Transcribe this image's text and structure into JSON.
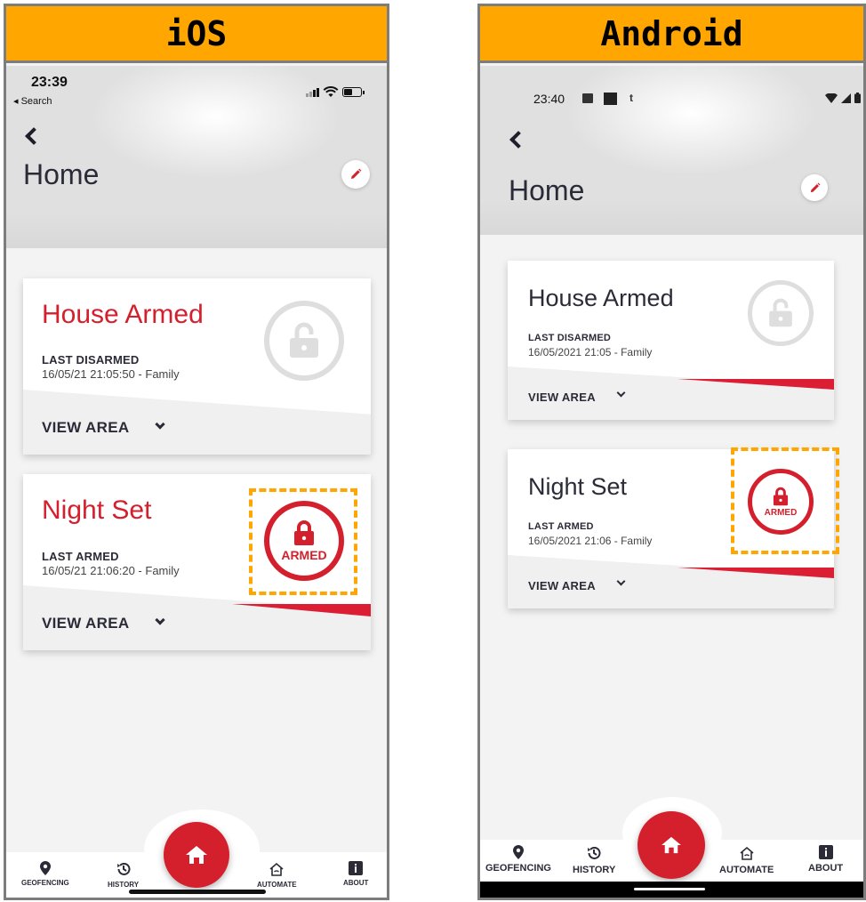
{
  "ios": {
    "banner": "iOS",
    "status": {
      "time": "23:39",
      "back_app": "◂ Search"
    },
    "title": "Home",
    "areas": [
      {
        "name": "House Armed",
        "last_label": "LAST DISARMED",
        "last_value": "16/05/21 21:05:50 - Family",
        "view_label": "VIEW AREA"
      },
      {
        "name": "Night Set",
        "last_label": "LAST ARMED",
        "last_value": "16/05/21 21:06:20 - Family",
        "view_label": "VIEW AREA",
        "state_label": "ARMED"
      }
    ],
    "nav": {
      "geofencing": "GEOFENCING",
      "history": "HISTORY",
      "automate": "AUTOMATE",
      "about": "ABOUT"
    }
  },
  "android": {
    "banner": "Android",
    "status": {
      "time": "23:40",
      "notif_t": "t"
    },
    "title": "Home",
    "areas": [
      {
        "name": "House Armed",
        "last_label": "LAST DISARMED",
        "last_value": "16/05/2021 21:05 - Family",
        "view_label": "VIEW AREA"
      },
      {
        "name": "Night Set",
        "last_label": "LAST ARMED",
        "last_value": "16/05/2021 21:06 - Family",
        "view_label": "VIEW AREA",
        "state_label": "ARMED"
      }
    ],
    "nav": {
      "geofencing": "GEOFENCING",
      "history": "HISTORY",
      "automate": "AUTOMATE",
      "about": "ABOUT"
    }
  },
  "colors": {
    "brand_red": "#d41f2d",
    "highlight": "#ffa600",
    "disarmed_grey": "#dedede",
    "text_dark": "#2b2b38"
  }
}
